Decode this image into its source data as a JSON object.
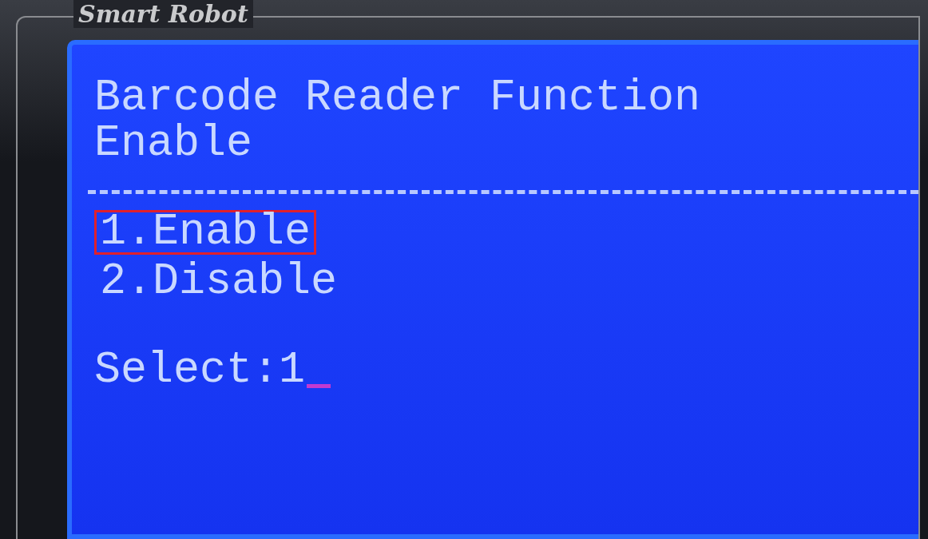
{
  "device": {
    "label": "Smart Robot"
  },
  "screen": {
    "title": "Barcode Reader Function",
    "current_value": "Enable",
    "options": [
      {
        "label": "1.Enable",
        "selected": true
      },
      {
        "label": "2.Disable",
        "selected": false
      }
    ],
    "prompt": {
      "label": "Select:",
      "value": "1"
    }
  }
}
